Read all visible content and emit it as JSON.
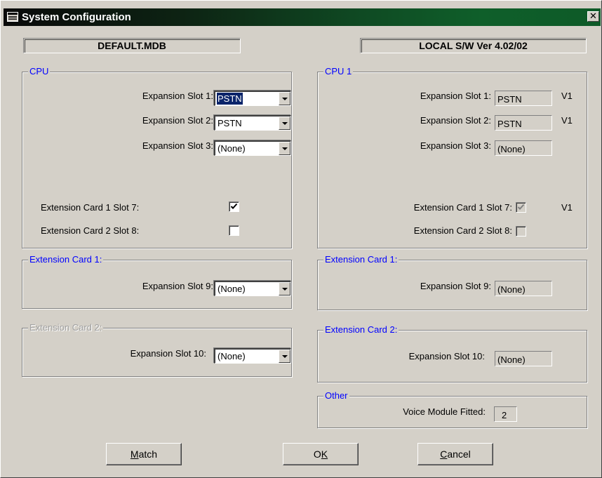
{
  "window": {
    "title": "System Configuration",
    "icon": "system-config-icon",
    "close_label": "✕"
  },
  "header": {
    "database": "DEFAULT.MDB",
    "local_version": "LOCAL S/W Ver 4.02/02"
  },
  "left": {
    "cpu_group": {
      "title": "CPU",
      "slot1_label": "Expansion Slot 1:",
      "slot1_value": "PSTN",
      "slot2_label": "Expansion Slot 2:",
      "slot2_value": "PSTN",
      "slot3_label": "Expansion Slot 3:",
      "slot3_value": "(None)",
      "ext_card1_label": "Extension Card 1 Slot 7:",
      "ext_card1_checked": true,
      "ext_card2_label": "Extension Card 2 Slot 8:",
      "ext_card2_checked": false
    },
    "ext1_group": {
      "title": "Extension Card 1:",
      "slot9_label": "Expansion Slot 9:",
      "slot9_value": "(None)"
    },
    "ext2_group": {
      "title": "Extension Card 2:",
      "slot10_label": "Expansion Slot 10:",
      "slot10_value": "(None)"
    }
  },
  "right": {
    "cpu_group": {
      "title": "CPU 1",
      "slot1_label": "Expansion Slot 1:",
      "slot1_value": "PSTN",
      "slot1_version": "V1",
      "slot2_label": "Expansion Slot 2:",
      "slot2_value": "PSTN",
      "slot2_version": "V1",
      "slot3_label": "Expansion Slot 3:",
      "slot3_value": "(None)",
      "ext_card1_label": "Extension Card 1 Slot 7:",
      "ext_card1_checked": true,
      "ext_card1_version": "V1",
      "ext_card2_label": "Extension Card 2 Slot 8:",
      "ext_card2_checked": false
    },
    "ext1_group": {
      "title": "Extension Card 1:",
      "slot9_label": "Expansion Slot 9:",
      "slot9_value": "(None)"
    },
    "ext2_group": {
      "title": "Extension Card 2:",
      "slot10_label": "Expansion Slot 10:",
      "slot10_value": "(None)"
    },
    "other_group": {
      "title": "Other",
      "voice_label": "Voice Module Fitted:",
      "voice_value": "2"
    }
  },
  "buttons": {
    "match": {
      "pre": "",
      "key": "M",
      "post": "atch"
    },
    "ok": {
      "pre": "O",
      "key": "K",
      "post": ""
    },
    "cancel": {
      "pre": "",
      "key": "C",
      "post": "ancel"
    }
  }
}
